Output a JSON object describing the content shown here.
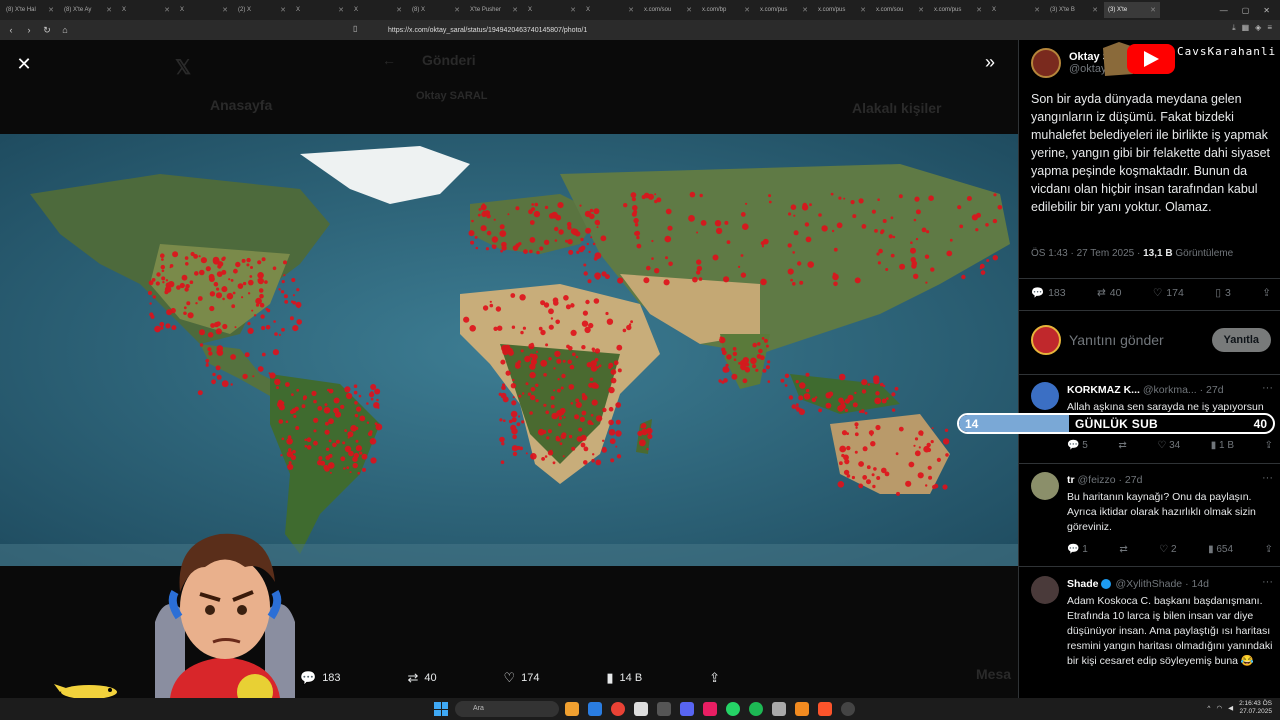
{
  "browser": {
    "tabs": [
      "(8) X'te Hal",
      "(8) X'te Ay",
      "X",
      "X",
      "(2) X",
      "X",
      "X",
      "(8) X",
      "X'te Pusher",
      "X",
      "X",
      "x.com/sou",
      "x.com/bp",
      "x.com/pus",
      "x.com/pus",
      "x.com/sou",
      "x.com/pus",
      "X",
      "(3) X'te B",
      "(3) X'te"
    ],
    "active_tab_index": 19,
    "url": "https://x.com/oktay_saral/status/1949420463740145807/photo/1"
  },
  "background_ghost": {
    "title": "Gönderi",
    "home": "Anasayfa",
    "author": "Oktay SARAL",
    "related": "Alakalı kişiler",
    "message": "Mesa"
  },
  "viewer": {
    "close_icon": "close-icon",
    "expand_icon": "double-chevron-right-icon",
    "actions": {
      "replies": "183",
      "reposts": "40",
      "likes": "174",
      "views": "14 B"
    }
  },
  "post": {
    "author_name": "Oktay S",
    "author_handle": "@oktay",
    "text": "Son bir ayda dünyada meydana gelen yangınların iz düşümü. Fakat bizdeki muhalefet belediyeleri ile birlikte iş yapmak yerine, yangın gibi bir felakette dahi siyaset yapma peşinde koşmaktadır. Bunun da vicdanı olan hiçbir insan tarafından kabul edilebilir bir yanı yoktur. Olamaz.",
    "time": "ÖS 1:43 · 27 Tem 2025 · ",
    "views_count": "13,1 B",
    "views_label": " Görüntüleme",
    "stats": {
      "replies": "183",
      "reposts": "40",
      "likes": "174",
      "bookmarks": "3"
    }
  },
  "reply": {
    "placeholder": "Yanıtını gönder",
    "button": "Yanıtla"
  },
  "overlay": {
    "channel": "CavsKarahanli",
    "sub_label": "GÜNLÜK SUB",
    "sub_current": "14",
    "sub_goal": "40",
    "sub_progress": 0.35
  },
  "comments": [
    {
      "name": "KORKMAZ K...",
      "handle": "@korkma...",
      "age": "· 27d",
      "text": "Allah aşkına sen sarayda ne iş yapıyorsun",
      "replies": "5",
      "reposts": "",
      "likes": "34",
      "views": "1 B"
    },
    {
      "name": "tr",
      "handle": "@feizzo · 27d",
      "age": "",
      "text": "Bu haritanın kaynağı? Onu da paylaşın. Ayrıca iktidar olarak hazırlıklı olmak sizin göreviniz.",
      "replies": "1",
      "reposts": "",
      "likes": "2",
      "views": "654"
    },
    {
      "name": "Shade",
      "handle": "@XylithShade",
      "age": "· 14d",
      "text": "Adam Koskoca C. başkanı başdanışmanı. Etrafında 10 larca iş bilen insan var diye düşünüyor insan. Ama paylaştığı ısı haritası resmini yangın haritası olmadığını yanındaki bir kişi cesaret edip söyleyemiş buna 😂"
    }
  ],
  "taskbar": {
    "search_placeholder": "Ara",
    "time": "2:16:43 ÖS",
    "date": "27.07.2025"
  }
}
